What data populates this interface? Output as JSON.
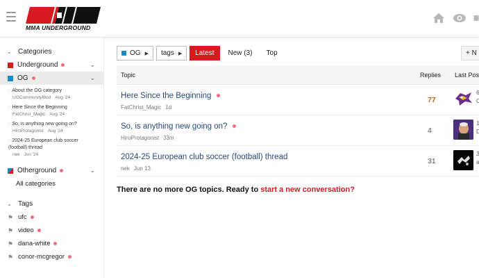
{
  "header": {
    "logo_text": "MMA UNDERGROUND",
    "icons": [
      "menu-icon",
      "home-icon",
      "eye-icon",
      "page-icon"
    ]
  },
  "sidebar": {
    "categories_label": "Categories",
    "categories": [
      {
        "name": "Underground",
        "color": "#d71920",
        "unread": true,
        "expandable": true
      },
      {
        "name": "OG",
        "color": "#1a8ad0",
        "unread": true,
        "expandable": true,
        "active": true
      }
    ],
    "og_topics": [
      {
        "title": "About the OG category",
        "author": "UGCommunityMod",
        "when": "Aug '24"
      },
      {
        "title": "Here Since the Beginning",
        "author": "FatChrist_Magic",
        "when": "Aug '24"
      },
      {
        "title": "So, is anything new going on?",
        "author": "HiroProtagonist",
        "when": "Aug '24"
      },
      {
        "title": "2024-25 European club soccer (football) thread",
        "author": "nek",
        "when": "Jun '24"
      }
    ],
    "other_category": {
      "name": "Otherground",
      "unread": true,
      "expandable": true
    },
    "all_categories": "All categories",
    "tags_label": "Tags",
    "tags": [
      {
        "name": "ufc",
        "unread": true
      },
      {
        "name": "video",
        "unread": true
      },
      {
        "name": "dana-white",
        "unread": true
      },
      {
        "name": "conor-mcgregor",
        "unread": true
      }
    ]
  },
  "nav": {
    "category_filter": "OG",
    "tags_filter": "tags",
    "latest": "Latest",
    "new": "New (3)",
    "top": "Top",
    "new_topic_button": "+ N"
  },
  "table": {
    "col_topic": "Topic",
    "col_replies": "Replies",
    "col_last": "Last Pos",
    "rows": [
      {
        "title": "Here Since the Beginning",
        "unread": true,
        "author": "FatChrist_Magic",
        "when": "1d",
        "replies": "77",
        "hot": true,
        "extra": [
          "6",
          "C"
        ]
      },
      {
        "title": "So, is anything new going on?",
        "unread": true,
        "author": "HiroProtagonist",
        "when": "33m",
        "replies": "4",
        "hot": false,
        "extra": [
          "1",
          "D"
        ]
      },
      {
        "title": "2024-25 European club soccer (football) thread",
        "unread": false,
        "author": "nek",
        "when": "Jun 13",
        "replies": "31",
        "hot": false,
        "extra": [
          "3",
          "a"
        ]
      }
    ]
  },
  "footer": {
    "message": "There are no more OG topics. Ready to ",
    "link": "start a new conversation?"
  }
}
